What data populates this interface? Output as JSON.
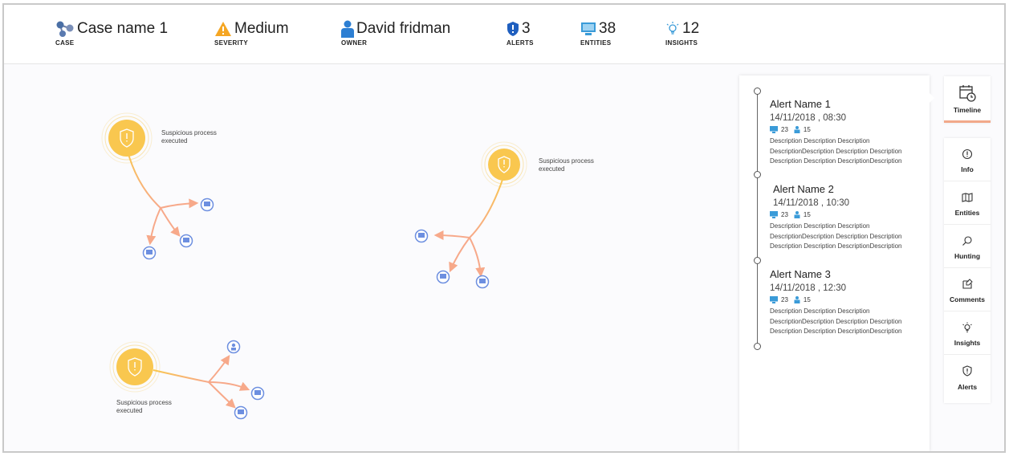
{
  "header": {
    "case": {
      "value": "Case name 1",
      "label": "CASE",
      "icon": "case-graph-icon"
    },
    "severity": {
      "value": "Medium",
      "label": "SEVERITY",
      "icon": "warning-triangle-icon",
      "color": "#f5a623"
    },
    "owner": {
      "value": "David fridman",
      "label": "OWNER",
      "icon": "person-icon",
      "color": "#2d7fd3"
    },
    "alerts": {
      "value": "3",
      "label": "ALERTS",
      "icon": "shield-alert-icon",
      "color": "#1f5fbf"
    },
    "entities": {
      "value": "38",
      "label": "ENTITIES",
      "icon": "monitor-icon",
      "color": "#3a9bd8"
    },
    "insights": {
      "value": "12",
      "label": "INSIGHTS",
      "icon": "lightbulb-icon",
      "color": "#3a9bd8"
    }
  },
  "graph": {
    "nodes": [
      {
        "label": "Suspicious process executed"
      },
      {
        "label": "Suspicious process executed"
      },
      {
        "label": "Suspicious process executed"
      }
    ],
    "colors": {
      "node": "#f9c74f",
      "arrow": "#f7a98a",
      "entity": "#6d8fe0"
    }
  },
  "timeline": {
    "alerts": [
      {
        "name": "Alert Name 1",
        "time": "14/11/2018 , 08:30",
        "hosts": "23",
        "users": "15",
        "desc1": "Description Description Description",
        "desc2": "DescriptionDescription Description Description",
        "desc3": "Description Description DescriptionDescription"
      },
      {
        "name": "Alert Name 2",
        "time": "14/11/2018 , 10:30",
        "hosts": "23",
        "users": "15",
        "desc1": "Description Description Description",
        "desc2": "DescriptionDescription Description Description",
        "desc3": "Description Description DescriptionDescription"
      },
      {
        "name": "Alert Name 3",
        "time": "14/11/2018 , 12:30",
        "hosts": "23",
        "users": "15",
        "desc1": "Description Description Description",
        "desc2": "DescriptionDescription Description Description",
        "desc3": "Description Description DescriptionDescription"
      }
    ]
  },
  "sidebar": {
    "active": {
      "label": "Timeline",
      "icon": "calendar-clock-icon"
    },
    "items": [
      {
        "label": "Info",
        "icon": "info-icon"
      },
      {
        "label": "Entities",
        "icon": "map-icon"
      },
      {
        "label": "Hunting",
        "icon": "search-icon"
      },
      {
        "label": "Comments",
        "icon": "comment-icon"
      },
      {
        "label": "Insights",
        "icon": "lightbulb-icon"
      },
      {
        "label": "Alerts",
        "icon": "shield-alert-icon"
      }
    ],
    "accent": "#f2a98a"
  }
}
